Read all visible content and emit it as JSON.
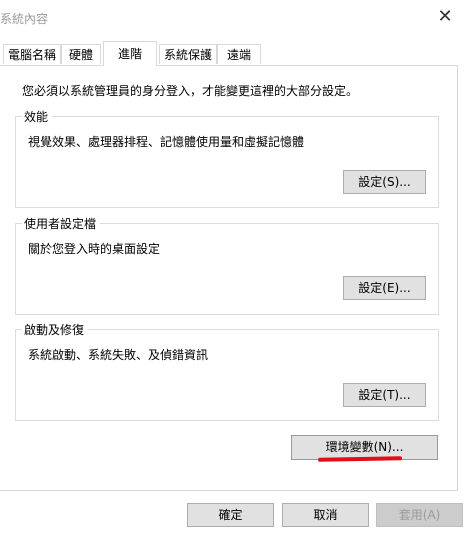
{
  "window": {
    "title": "系統內容",
    "close_glyph": "✕"
  },
  "tabs": [
    {
      "label": "電腦名稱"
    },
    {
      "label": "硬體"
    },
    {
      "label": "進階"
    },
    {
      "label": "系統保護"
    },
    {
      "label": "遠端"
    }
  ],
  "intro": "您必須以系統管理員的身分登入，才能變更這裡的大部分設定。",
  "performance": {
    "title": "效能",
    "desc": "視覺效果、處理器排程、記憶體使用量和虛擬記憶體",
    "button": "設定(S)..."
  },
  "user_profiles": {
    "title": "使用者設定檔",
    "desc": "關於您登入時的桌面設定",
    "button": "設定(E)..."
  },
  "startup": {
    "title": "啟動及修復",
    "desc": "系統啟動、系統失敗、及偵錯資訊",
    "button": "設定(T)..."
  },
  "env_button": "環境變數(N)...",
  "footer": {
    "ok": "確定",
    "cancel": "取消",
    "apply": "套用(A)"
  },
  "colors": {
    "annotation": "#e0101a",
    "button_face": "#e1e1e1"
  }
}
